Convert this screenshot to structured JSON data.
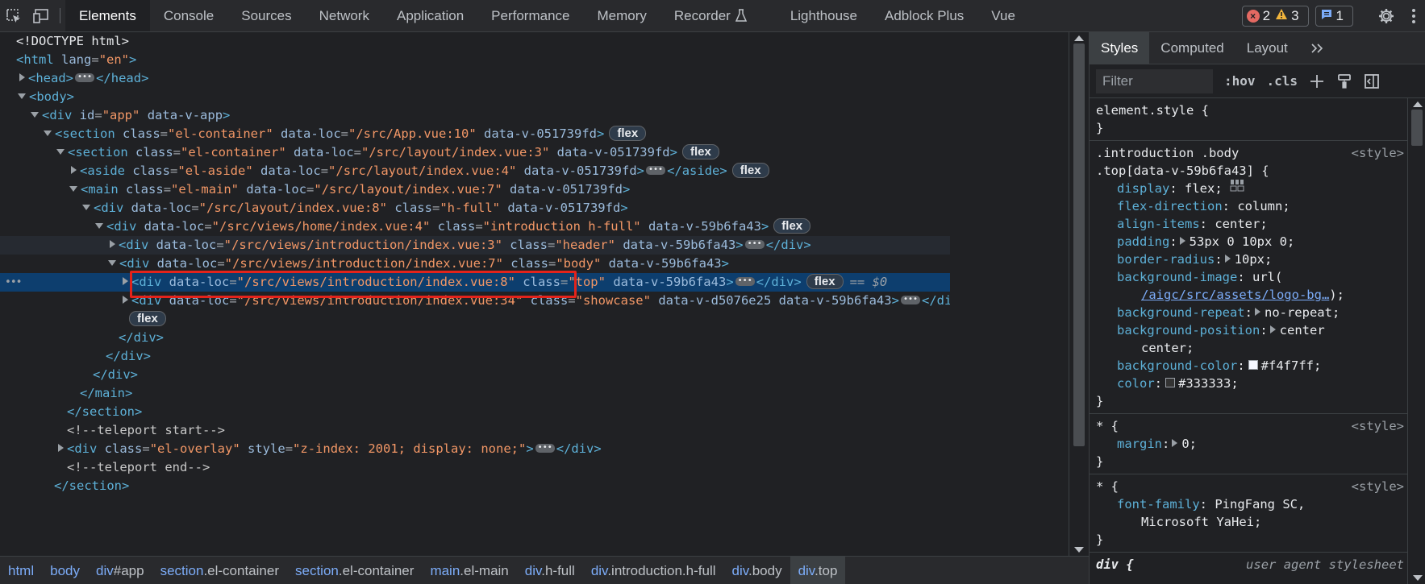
{
  "toolbar": {
    "tabs": [
      "Elements",
      "Console",
      "Sources",
      "Network",
      "Application",
      "Performance",
      "Memory",
      "Recorder",
      "Lighthouse",
      "Adblock Plus",
      "Vue"
    ],
    "active_tab": "Elements",
    "errors": "2",
    "warnings": "3",
    "messages": "1"
  },
  "dom": {
    "doctype": "<!DOCTYPE html>",
    "html_tag": "html",
    "html_lang_attr": "lang",
    "html_lang_val": "\"en\"",
    "head_tag": "head",
    "body_tag": "body",
    "app_id_val": "\"app\"",
    "app_attr": "data-v-app",
    "sec1_loc": "\"/src/App.vue:10\"",
    "sec1_attr": "data-v-051739fd",
    "sec2_loc": "\"/src/layout/index.vue:3\"",
    "sec2_attr": "data-v-051739fd",
    "aside_class": "\"el-aside\"",
    "aside_loc": "\"/src/layout/index.vue:4\"",
    "aside_attr": "data-v-051739fd",
    "main_class": "\"el-main\"",
    "main_loc": "\"/src/layout/index.vue:7\"",
    "main_attr": "data-v-051739fd",
    "hfull_loc": "\"/src/layout/index.vue:8\"",
    "hfull_class": "\"h-full\"",
    "hfull_attr": "data-v-051739fd",
    "intro_loc": "\"/src/views/home/index.vue:4\"",
    "intro_class": "\"introduction h-full\"",
    "intro_attr": "data-v-59b6fa43",
    "header_loc": "\"/src/views/introduction/index.vue:3\"",
    "header_class": "\"header\"",
    "header_attr": "data-v-59b6fa43",
    "body_loc": "\"/src/views/introduction/index.vue:7\"",
    "body_class": "\"body\"",
    "body_attr": "data-v-59b6fa43",
    "top_loc": "\"/src/views/introduction/index.vue:8\"",
    "top_class": "\"top\"",
    "top_attr": "data-v-59b6fa43",
    "show_loc": "\"/src/views/introduction/index.vue:34\"",
    "show_class": "\"showcase\"",
    "show_attr": "data-v-d5076e25 data-v-59b6fa43",
    "overlay_class": "\"el-overlay\"",
    "overlay_style": "\"z-index: 2001; display: none;\"",
    "teleport_start": "<!--teleport start-->",
    "teleport_end": "<!--teleport end-->",
    "flex_badge": "flex",
    "selected_marker": "== $0"
  },
  "breadcrumb": [
    {
      "tag": "html",
      "cls": ""
    },
    {
      "tag": "body",
      "cls": ""
    },
    {
      "tag": "div",
      "cls": "#app"
    },
    {
      "tag": "section",
      "cls": ".el-container"
    },
    {
      "tag": "section",
      "cls": ".el-container"
    },
    {
      "tag": "main",
      "cls": ".el-main"
    },
    {
      "tag": "div",
      "cls": ".h-full"
    },
    {
      "tag": "div",
      "cls": ".introduction.h-full"
    },
    {
      "tag": "div",
      "cls": ".body"
    },
    {
      "tag": "div",
      "cls": ".top"
    }
  ],
  "styles": {
    "tabs": [
      "Styles",
      "Computed",
      "Layout"
    ],
    "filter_placeholder": "Filter",
    "hov": ":hov",
    "cls": ".cls",
    "element_style": "element.style {",
    "close_brace": "}",
    "rule1_sel_a": ".introduction .body",
    "rule1_sel_b": ".top[data-v-59b6fa43] {",
    "origin_style": "<style>",
    "origin_ua": "user agent stylesheet",
    "props": [
      {
        "n": "display",
        "v": "flex;"
      },
      {
        "n": "flex-direction",
        "v": "column;"
      },
      {
        "n": "align-items",
        "v": "center;"
      },
      {
        "n": "padding",
        "v": "53px 0 10px 0;"
      },
      {
        "n": "border-radius",
        "v": "10px;"
      },
      {
        "n": "background-image",
        "v": "url("
      },
      {
        "n": "background-repeat",
        "v": "no-repeat;"
      },
      {
        "n": "background-position",
        "v": "center"
      },
      {
        "n": "background-color",
        "v": "#f4f7ff;"
      },
      {
        "n": "color",
        "v": "#333333;"
      }
    ],
    "bg_url": "/aigc/src/assets/logo-bg…",
    "bg_url_close": ");",
    "bg_pos_cont": "center;",
    "star_sel": "* {",
    "margin_n": "margin",
    "margin_v": "0;",
    "font_n": "font-family",
    "font_v1": "PingFang SC,",
    "font_v2": "Microsoft YaHei;",
    "div_sel": "div {",
    "colors": {
      "bg_color_swatch": "#f4f7ff",
      "color_swatch": "#333333"
    }
  }
}
